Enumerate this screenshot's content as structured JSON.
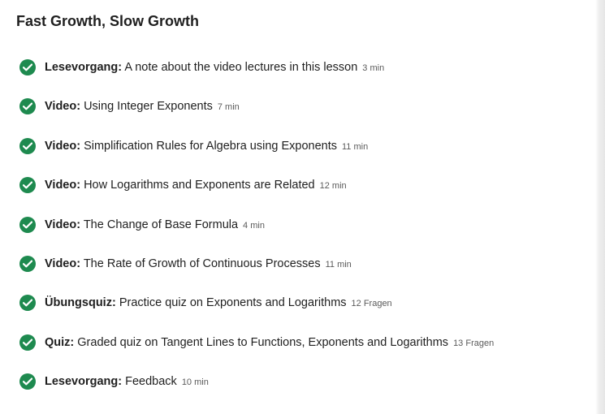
{
  "section": {
    "title": "Fast Growth, Slow Growth"
  },
  "items": [
    {
      "kind": "Lesevorgang:",
      "name": "A note about the video lectures in this lesson",
      "meta": "3 min",
      "status": "completed"
    },
    {
      "kind": "Video:",
      "name": "Using Integer Exponents",
      "meta": "7 min",
      "status": "completed"
    },
    {
      "kind": "Video:",
      "name": "Simplification Rules for Algebra using Exponents",
      "meta": "11 min",
      "status": "completed"
    },
    {
      "kind": "Video:",
      "name": "How Logarithms and Exponents are Related",
      "meta": "12 min",
      "status": "completed"
    },
    {
      "kind": "Video:",
      "name": "The Change of Base Formula",
      "meta": "4 min",
      "status": "completed"
    },
    {
      "kind": "Video:",
      "name": "The Rate of Growth of Continuous Processes",
      "meta": "11 min",
      "status": "completed"
    },
    {
      "kind": "Übungsquiz:",
      "name": "Practice quiz on Exponents and Logarithms",
      "meta": "12 Fragen",
      "status": "completed"
    },
    {
      "kind": "Quiz:",
      "name": "Graded quiz on Tangent Lines to Functions, Exponents and Logarithms",
      "meta": "13 Fragen",
      "status": "completed"
    },
    {
      "kind": "Lesevorgang:",
      "name": "Feedback",
      "meta": "10 min",
      "status": "completed"
    }
  ],
  "colors": {
    "check": "#1e8a4f",
    "meta": "#5b5b5b"
  },
  "icons": {
    "status": "checkmark-circle-icon"
  }
}
